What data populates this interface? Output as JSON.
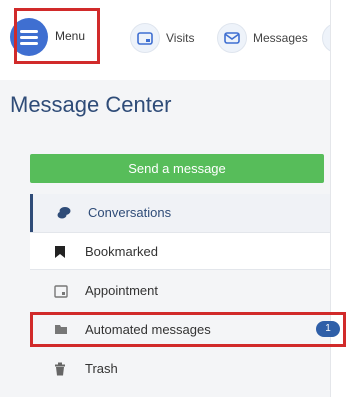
{
  "nav": {
    "menu_label": "Menu",
    "visits_label": "Visits",
    "messages_label": "Messages"
  },
  "page": {
    "title": "Message Center"
  },
  "actions": {
    "send_label": "Send a message"
  },
  "sidebar": {
    "items": [
      {
        "label": "Conversations",
        "icon": "chat-icon"
      },
      {
        "label": "Bookmarked",
        "icon": "bookmark-icon"
      },
      {
        "label": "Appointment",
        "icon": "calendar-icon"
      },
      {
        "label": "Automated messages",
        "icon": "folder-icon",
        "badge": "1"
      },
      {
        "label": "Trash",
        "icon": "trash-icon"
      }
    ]
  },
  "colors": {
    "brand_blue": "#3f6fd1",
    "title_blue": "#2f4c78",
    "send_green": "#57bd5a",
    "highlight_red": "#d12a2a",
    "badge_blue": "#2f5fa8"
  }
}
